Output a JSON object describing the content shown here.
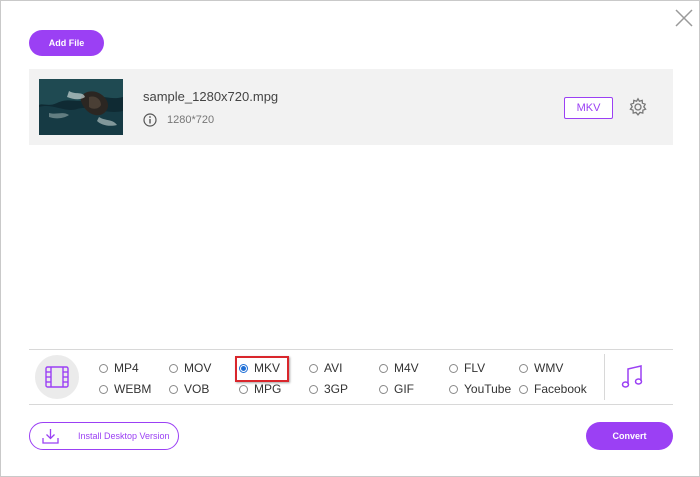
{
  "toolbar": {
    "add_file_label": "Add File"
  },
  "file": {
    "name": "sample_1280x720.mpg",
    "resolution": "1280*720",
    "output_format": "MKV"
  },
  "formats": {
    "selected": "MKV",
    "video": [
      [
        "MP4",
        "MOV",
        "MKV",
        "AVI",
        "M4V",
        "FLV",
        "WMV"
      ],
      [
        "WEBM",
        "VOB",
        "MPG",
        "3GP",
        "GIF",
        "YouTube",
        "Facebook"
      ]
    ]
  },
  "footer": {
    "install_label": "Install Desktop Version",
    "convert_label": "Convert"
  },
  "icons": {
    "close": "close-icon",
    "info": "info-icon",
    "settings": "gear-icon",
    "video_tab": "film-icon",
    "audio_tab": "music-note-icon",
    "install": "download-icon"
  },
  "colors": {
    "accent": "#9b40f4",
    "selection_highlight": "#d9262c",
    "radio_checked": "#1f6fd6"
  }
}
